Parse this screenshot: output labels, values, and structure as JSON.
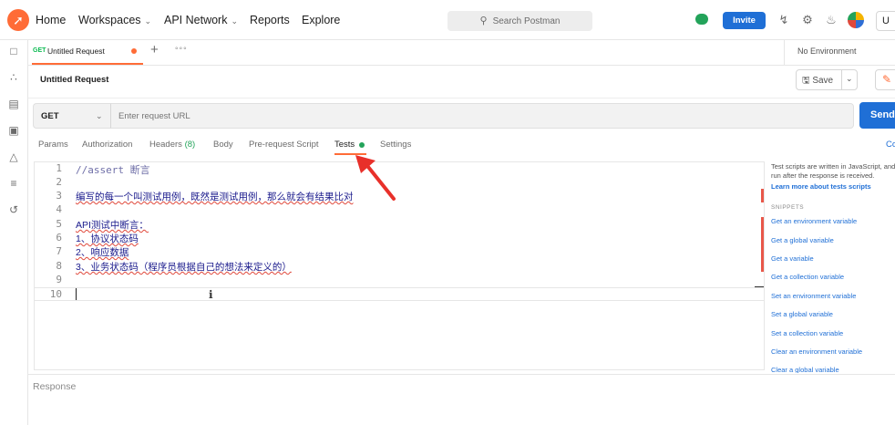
{
  "topbar": {
    "nav": [
      "Home",
      "Workspaces",
      "API Network",
      "Reports",
      "Explore"
    ],
    "search_placeholder": "Search Postman",
    "invite": "Invite",
    "upgrade": "U"
  },
  "tab": {
    "method": "GET",
    "name": "Untitled Request"
  },
  "environment": "No Environment",
  "request": {
    "title": "Untitled Request",
    "save": "Save",
    "method": "GET",
    "url_placeholder": "Enter request URL",
    "send": "Send"
  },
  "request_tabs": [
    "Params",
    "Authorization",
    "Headers",
    "Body",
    "Pre-request Script",
    "Tests",
    "Settings"
  ],
  "headers_count": "(8)",
  "cookies": "Co",
  "editor": {
    "line_numbers": [
      "1",
      "2",
      "3",
      "4",
      "5",
      "6",
      "7",
      "8",
      "9",
      "10"
    ],
    "lines": [
      "//assert 断言",
      "",
      "编写的每一个叫测试用例，既然是测试用例，那么就会有结果比对",
      "",
      "API测试中断言：",
      "1、协议状态码",
      "2、响应数据",
      "3、业务状态码（程序员根据自己的想法来定义的）",
      "",
      ""
    ]
  },
  "snippets": {
    "description": "Test scripts are written in JavaScript, and are run after the response is received.",
    "learn_more": "Learn more about tests scripts",
    "heading": "SNIPPETS",
    "items": [
      "Get an environment variable",
      "Get a global variable",
      "Get a variable",
      "Get a collection variable",
      "Set an environment variable",
      "Set a global variable",
      "Set a collection variable",
      "Clear an environment variable",
      "Clear a global variable"
    ]
  },
  "response_label": "Response",
  "colors": {
    "brand": "#ff6c37",
    "primary": "#1f6fd6",
    "success": "#23a35a",
    "annotation": "#e8302a"
  },
  "icons": [
    "postman-logo-icon",
    "search-icon",
    "cloud-sync-icon",
    "satellite-icon",
    "gear-icon",
    "bell-icon",
    "avatar"
  ]
}
